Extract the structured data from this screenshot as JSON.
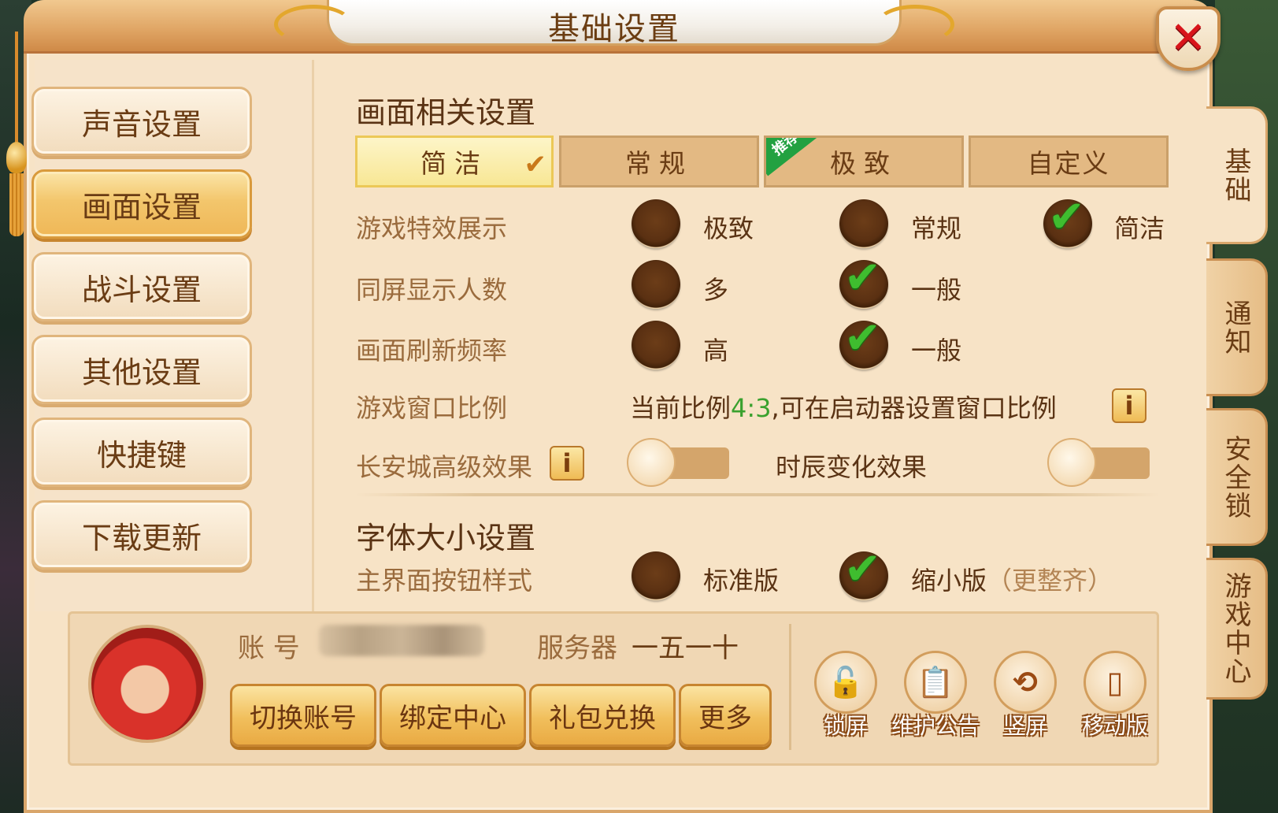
{
  "window": {
    "title": "基础设置",
    "close_symbol": "✕"
  },
  "left_nav": {
    "items": [
      {
        "label": "声音设置",
        "active": false
      },
      {
        "label": "画面设置",
        "active": true
      },
      {
        "label": "战斗设置",
        "active": false
      },
      {
        "label": "其他设置",
        "active": false
      },
      {
        "label": "快捷键",
        "active": false
      },
      {
        "label": "下载更新",
        "active": false
      }
    ]
  },
  "side_tabs": [
    {
      "label": "基础",
      "active": true
    },
    {
      "label": "通知",
      "active": false
    },
    {
      "label": "安全锁",
      "active": false
    },
    {
      "label": "游戏中心",
      "active": false
    }
  ],
  "display": {
    "section_title": "画面相关设置",
    "modes": [
      {
        "label": "简洁",
        "active": true,
        "check": "✔"
      },
      {
        "label": "常规",
        "active": false
      },
      {
        "label": "极致",
        "active": false,
        "ribbon": "推荐"
      },
      {
        "label": "自定义",
        "active": false
      }
    ],
    "effects": {
      "label": "游戏特效展示",
      "options": [
        "极致",
        "常规",
        "简洁"
      ],
      "selected": "简洁"
    },
    "players": {
      "label": "同屏显示人数",
      "options": [
        "多",
        "一般"
      ],
      "selected": "一般"
    },
    "refresh": {
      "label": "画面刷新频率",
      "options": [
        "高",
        "一般"
      ],
      "selected": "一般"
    },
    "window_ratio": {
      "label": "游戏窗口比例",
      "text_before": "当前比例",
      "ratio": "4:3",
      "text_after": ",可在启动器设置窗口比例",
      "info": "i"
    },
    "changan": {
      "label": "长安城高级效果",
      "info": "i",
      "enabled": false
    },
    "time_change": {
      "label": "时辰变化效果",
      "enabled": false
    }
  },
  "font": {
    "section_title": "字体大小设置",
    "style": {
      "label": "主界面按钮样式",
      "options": [
        "标准版",
        "缩小版"
      ],
      "note": "（更整齐）",
      "selected": "缩小版"
    }
  },
  "account": {
    "account_label": "账 号",
    "server_label": "服务器",
    "server_value": "一五一十",
    "buttons": [
      "切换账号",
      "绑定中心",
      "礼包兑换",
      "更多"
    ]
  },
  "tools": [
    {
      "label": "锁屏",
      "icon": "lock-icon",
      "glyph": "🔓"
    },
    {
      "label": "维护公告",
      "icon": "clipboard-icon",
      "glyph": "📋"
    },
    {
      "label": "竖屏",
      "icon": "rotate-screen-icon",
      "glyph": "⟲"
    },
    {
      "label": "移动版",
      "icon": "phone-icon",
      "glyph": "▯"
    }
  ],
  "colors": {
    "panel_bg": "#f7e3c6",
    "check_green": "#3fbd2f",
    "highlight_ratio": "#3aa12e",
    "close_red": "#d8141b"
  }
}
